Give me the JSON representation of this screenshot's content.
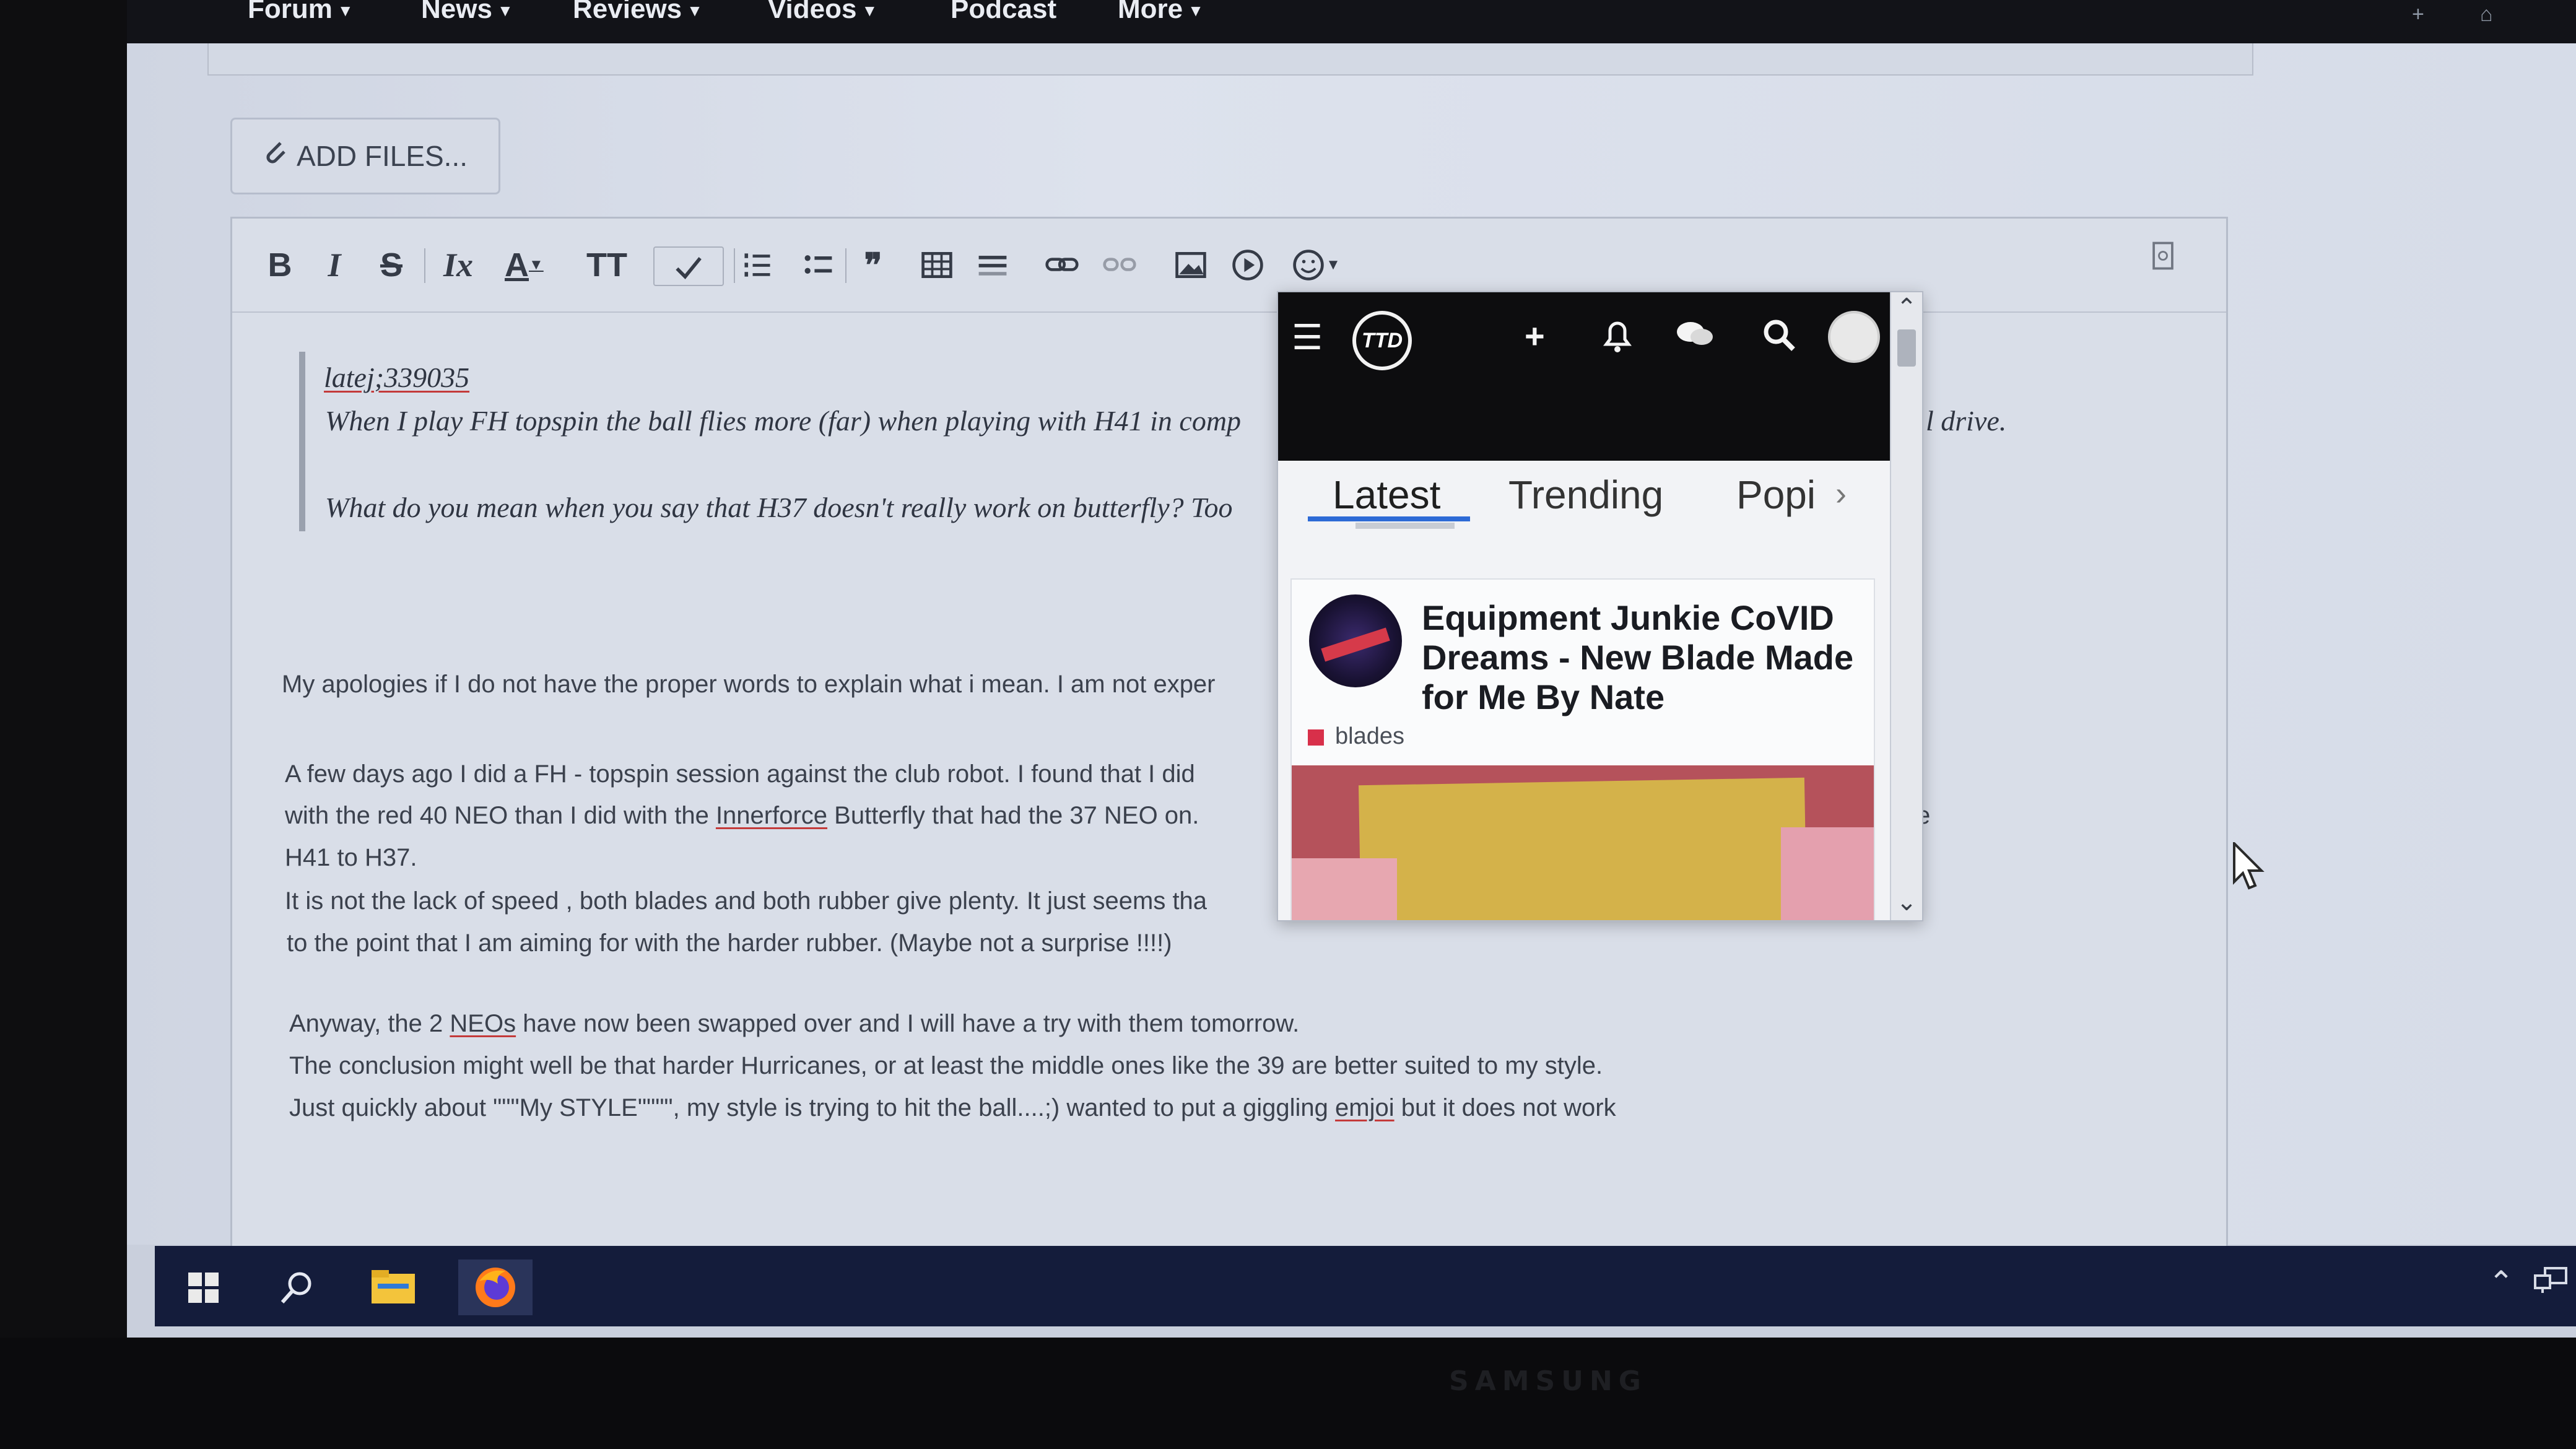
{
  "site_nav": {
    "items": [
      "Forum",
      "News",
      "Reviews",
      "Videos",
      "Podcast",
      "More"
    ],
    "caret_items": [
      true,
      true,
      true,
      true,
      false,
      true
    ]
  },
  "add_files": {
    "label": "ADD FILES..."
  },
  "toolbar": {
    "bold": "B",
    "italic": "I",
    "strike": "S",
    "clear_format": "Ix",
    "text_color": "A",
    "font_size": "TT",
    "icons": [
      "bold-icon",
      "italic-icon",
      "strikethrough-icon",
      "clear-format-icon",
      "text-color-icon",
      "font-size-icon",
      "spellcheck-icon",
      "ordered-list-icon",
      "bullet-list-icon",
      "quote-icon",
      "table-icon",
      "horizontal-rule-icon",
      "link-icon",
      "unlink-icon",
      "image-icon",
      "media-icon",
      "emoji-icon",
      "source-icon"
    ]
  },
  "quote": {
    "author": "latej;339035",
    "line1": "When I play FH topspin the ball flies more (far) when playing with H41 in comp",
    "line1_tail": "l drive.",
    "line2": "What do you mean when you say that H37 doesn't really work on butterfly? Too"
  },
  "body": {
    "p1": "My apologies if I do not have the proper words to explain what i mean. I am not exper",
    "p2_l1": "A few days ago I did a FH - topspin session against  the club robot. I found that I did",
    "p2_l2_a": "with the red 40 NEO than  I did with the ",
    "p2_l2_b": "Innerforce",
    "p2_l2_c": " Butterfly that had the 37 NEO on.",
    "p2_l2_tail": "e",
    "p2_l3": "H41 to H37.",
    "p2_l4": "It is not the lack of speed , both blades and both rubber give plenty. It just seems tha",
    "p2_l5": "to the point that I am aiming for with the harder rubber.   (Maybe not a surprise !!!!)",
    "p3_l1_a": "Anyway, the 2 ",
    "p3_l1_b": "NEOs",
    "p3_l1_c": " have now been swapped over and I will have a try with them tomorrow.",
    "p3_l2": "The conclusion might well be that harder Hurricanes, or at least the middle ones like the 39  are better suited to my style.",
    "p3_l3_a": "Just quickly about \"\"\"My STYLE\"\"\"\",  my style is trying to hit the ball....;)     wanted to put a giggling ",
    "p3_l3_b": "emjoi",
    "p3_l3_c": " but it does not work"
  },
  "popup": {
    "logo_text": "TTD",
    "tabs": [
      "Latest",
      "Trending",
      "Popi"
    ],
    "active_tab": "Latest",
    "card": {
      "title": "Equipment Junkie CoVID Dreams - New Blade Made for Me By Nate",
      "tag": "blades",
      "tag_color": "#d8304a"
    }
  },
  "brand": {
    "monitor": "SAMSUNG"
  },
  "colors": {
    "accent": "#2d6ad6",
    "nav_bg": "#121318",
    "taskbar": "#141c3b"
  }
}
